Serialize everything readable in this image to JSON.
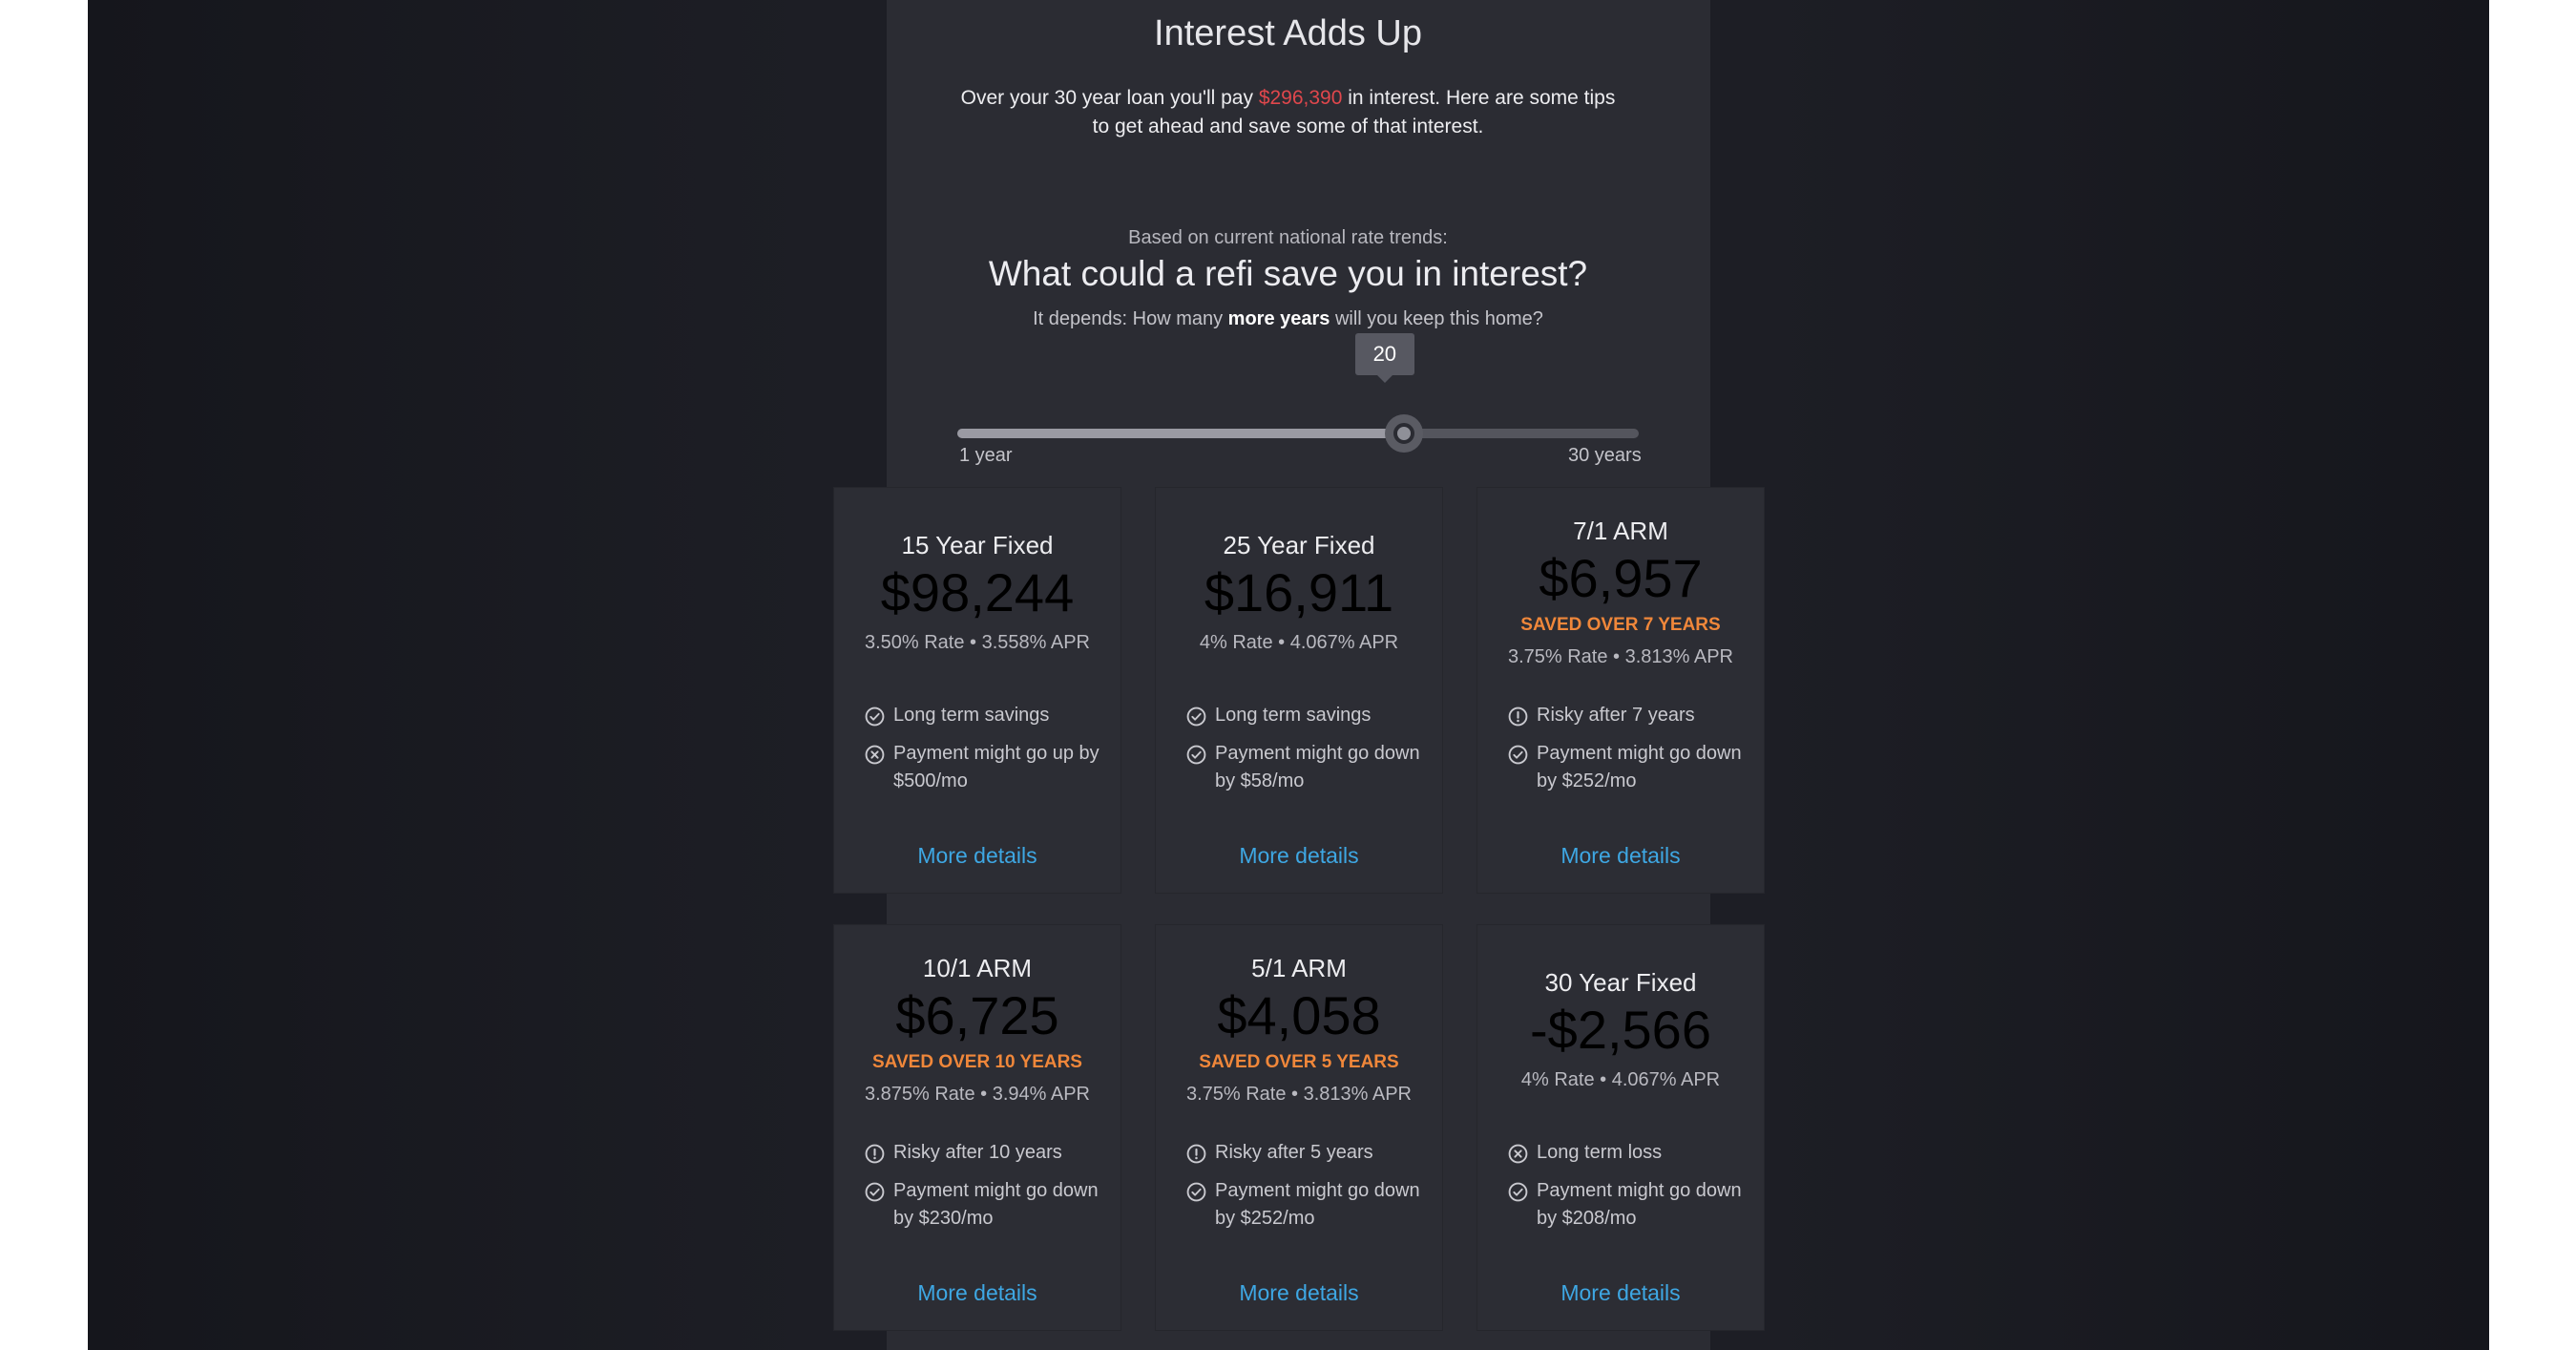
{
  "header": {
    "title": "Interest Adds Up",
    "intro_before": "Over your 30 year loan you'll pay ",
    "interest_total": "$296,390",
    "intro_after": " in interest. Here are some tips",
    "intro_line2": "to get ahead and save some of that interest."
  },
  "refi": {
    "rate_trends": "Based on current national rate trends:",
    "heading": "What could a refi save you in interest?",
    "sub_before": "It depends: How many ",
    "sub_bold": "more years",
    "sub_after": " will you keep this home?"
  },
  "slider": {
    "value": 20,
    "min": 1,
    "max": 30,
    "value_label": "20",
    "min_label": "1 year",
    "max_label": "30 years"
  },
  "colors": {
    "positive": "#37c46f",
    "warning": "#f0873a",
    "negative": "#e0474c",
    "link": "#3ea7e3"
  },
  "cards": [
    {
      "name": "15 Year Fixed",
      "amount": "$98,244",
      "tone": "positive",
      "saved": "",
      "rate": "3.50% Rate • 3.558% APR",
      "features": [
        {
          "icon": "check-circle-icon",
          "tone": "positive",
          "text": "Long term savings"
        },
        {
          "icon": "x-circle-icon",
          "tone": "negative",
          "text": "Payment might go up by $500/mo"
        }
      ],
      "details": "More details"
    },
    {
      "name": "25 Year Fixed",
      "amount": "$16,911",
      "tone": "positive",
      "saved": "",
      "rate": "4% Rate • 4.067% APR",
      "features": [
        {
          "icon": "check-circle-icon",
          "tone": "positive",
          "text": "Long term savings"
        },
        {
          "icon": "check-circle-icon",
          "tone": "positive",
          "text": "Payment might go down by $58/mo"
        }
      ],
      "details": "More details"
    },
    {
      "name": "7/1 ARM",
      "amount": "$6,957",
      "tone": "warning",
      "saved": "SAVED OVER 7 YEARS",
      "rate": "3.75% Rate • 3.813% APR",
      "features": [
        {
          "icon": "info-circle-icon",
          "tone": "warning",
          "text": "Risky after 7 years"
        },
        {
          "icon": "check-circle-icon",
          "tone": "positive",
          "text": "Payment might go down by $252/mo"
        }
      ],
      "details": "More details"
    },
    {
      "name": "10/1 ARM",
      "amount": "$6,725",
      "tone": "warning",
      "saved": "SAVED OVER 10 YEARS",
      "rate": "3.875% Rate • 3.94% APR",
      "features": [
        {
          "icon": "info-circle-icon",
          "tone": "warning",
          "text": "Risky after 10 years"
        },
        {
          "icon": "check-circle-icon",
          "tone": "positive",
          "text": "Payment might go down by $230/mo"
        }
      ],
      "details": "More details"
    },
    {
      "name": "5/1 ARM",
      "amount": "$4,058",
      "tone": "warning",
      "saved": "SAVED OVER 5 YEARS",
      "rate": "3.75% Rate • 3.813% APR",
      "features": [
        {
          "icon": "info-circle-icon",
          "tone": "warning",
          "text": "Risky after 5 years"
        },
        {
          "icon": "check-circle-icon",
          "tone": "positive",
          "text": "Payment might go down by $252/mo"
        }
      ],
      "details": "More details"
    },
    {
      "name": "30 Year Fixed",
      "amount": "-$2,566",
      "tone": "negative",
      "saved": "",
      "rate": "4% Rate • 4.067% APR",
      "features": [
        {
          "icon": "x-circle-icon",
          "tone": "negative",
          "text": "Long term loss"
        },
        {
          "icon": "check-circle-icon",
          "tone": "positive",
          "text": "Payment might go down by $208/mo"
        }
      ],
      "details": "More details"
    }
  ]
}
